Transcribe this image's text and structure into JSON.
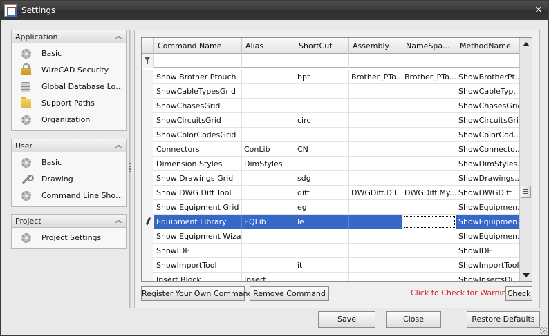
{
  "window": {
    "title": "Settings",
    "close_glyph": "×"
  },
  "sidebar": {
    "groups": [
      {
        "title": "Application",
        "items": [
          {
            "label": "Basic",
            "icon": "gear-icon"
          },
          {
            "label": "WireCAD Security",
            "icon": "lock-icon"
          },
          {
            "label": "Global Database Loc...",
            "icon": "database-icon"
          },
          {
            "label": "Support Paths",
            "icon": "folder-icon"
          },
          {
            "label": "Organization",
            "icon": "gear-icon"
          }
        ]
      },
      {
        "title": "User",
        "items": [
          {
            "label": "Basic",
            "icon": "gear-icon"
          },
          {
            "label": "Drawing",
            "icon": "wrench-icon"
          },
          {
            "label": "Command Line Short...",
            "icon": "gear-icon"
          }
        ]
      },
      {
        "title": "Project",
        "items": [
          {
            "label": "Project Settings",
            "icon": "gear-icon"
          }
        ]
      }
    ],
    "collapse_glyph": "︽"
  },
  "grid": {
    "columns": [
      "Command Name",
      "Alias",
      "ShortCut",
      "Assembly",
      "NameSpa...",
      "MethodName"
    ],
    "rows": [
      [
        "Show Brother Ptouch",
        "",
        "bpt",
        "Brother_PTo...",
        "Brother_PTo...",
        "ShowBrotherPt..."
      ],
      [
        "ShowCableTypesGrid",
        "",
        "",
        "",
        "",
        "ShowCableTyp..."
      ],
      [
        "ShowChasesGrid",
        "",
        "",
        "",
        "",
        "ShowChasesGrid"
      ],
      [
        "ShowCircuitsGrid",
        "",
        "circ",
        "",
        "",
        "ShowCircuitsGrid"
      ],
      [
        "ShowColorCodesGrid",
        "",
        "",
        "",
        "",
        "ShowColorCod..."
      ],
      [
        "Connectors",
        "ConLib",
        "CN",
        "",
        "",
        "ShowConnecto..."
      ],
      [
        "Dimension Styles",
        "DimStyles",
        "",
        "",
        "",
        "ShowDimStyles..."
      ],
      [
        "Show Drawings Grid",
        "",
        "sdg",
        "",
        "",
        "ShowDrawings..."
      ],
      [
        "Show DWG Diff Tool",
        "",
        "diff",
        "DWGDiff.Dll",
        "DWGDiff.My...",
        "ShowDWGDiff"
      ],
      [
        "Show Equipment Grid",
        "",
        "eg",
        "",
        "",
        "ShowEquipmen..."
      ],
      [
        "Equipment Library",
        "EQLib",
        "le",
        "",
        "",
        "ShowEquipmen..."
      ],
      [
        "Show Equipment Wizard",
        "",
        "",
        "",
        "",
        "ShowEquipmen..."
      ],
      [
        "ShowIDE",
        "",
        "",
        "",
        "",
        "ShowIDE"
      ],
      [
        "ShowImportTool",
        "",
        "it",
        "",
        "",
        "ShowImportTool"
      ],
      [
        "Insert Block",
        "Insert",
        "",
        "",
        "",
        "ShowInsertsDi..."
      ]
    ],
    "selected_row": 10
  },
  "actions": {
    "register_label": "Register Your Own Command",
    "remove_label": "Remove Command",
    "warning_text": "Click to Check for Warnings",
    "check_label": "Check"
  },
  "footer": {
    "save_label": "Save",
    "close_label": "Close",
    "restore_label": "Restore Defaults"
  },
  "colors": {
    "selection": "#3668c8",
    "warning": "#d42020",
    "titlebar": "#3a3a3a"
  }
}
